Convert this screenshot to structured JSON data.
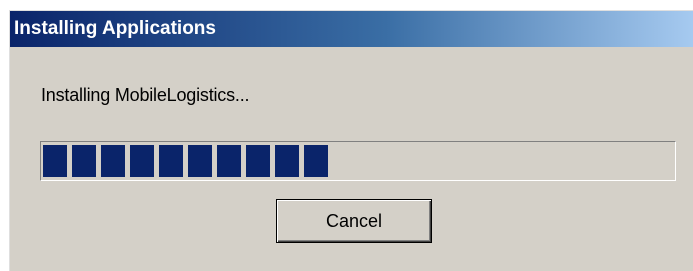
{
  "dialog": {
    "title": "Installing Applications",
    "status_text": "Installing MobileLogistics...",
    "cancel_label": "Cancel"
  },
  "progress": {
    "fraction": 0.47,
    "blocks_filled": 10,
    "fill_color": "#0a246a"
  },
  "colors": {
    "window_bg": "#d4d0c8",
    "title_gradient_start": "#0a246a",
    "title_gradient_end": "#a6caf0",
    "title_text": "#ffffff"
  }
}
